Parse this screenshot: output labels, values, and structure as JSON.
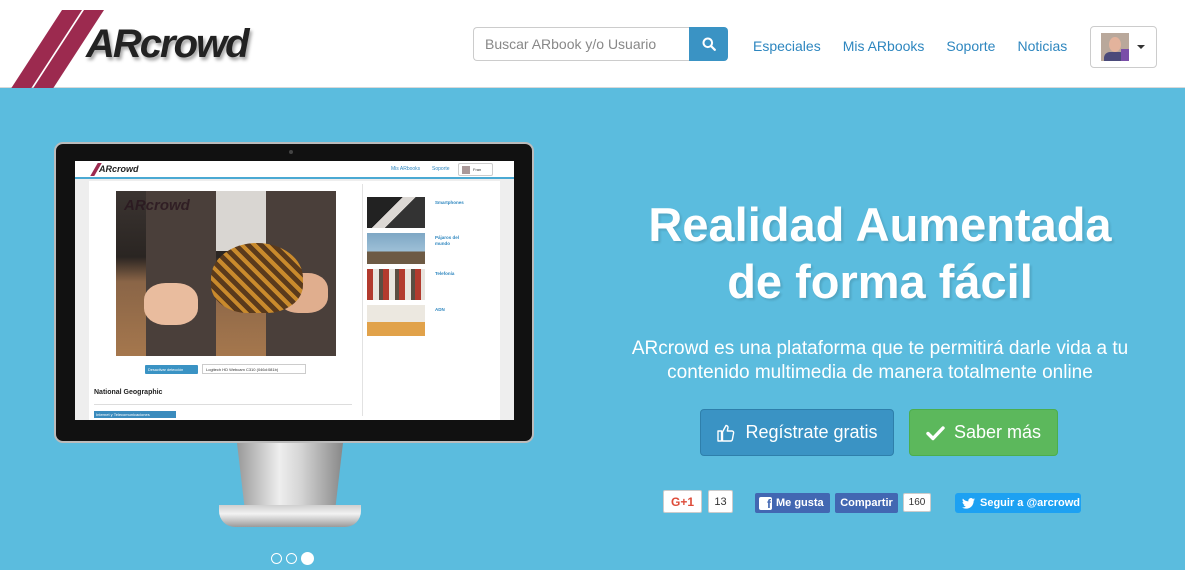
{
  "brand": {
    "logo_text": "ARcrowd",
    "color": "#9c2a4f"
  },
  "search": {
    "placeholder": "Buscar ARbook y/o Usuario",
    "button_icon": "search-icon"
  },
  "nav": {
    "links": [
      "Especiales",
      "Mis ARbooks",
      "Soporte",
      "Noticias"
    ]
  },
  "user_menu": {
    "icon": "avatar",
    "caret": "chevron-down-icon"
  },
  "hero": {
    "title_line1": "Realidad Aumentada",
    "title_line2": "de forma fácil",
    "subtitle_line1": "ARcrowd es una plataforma que te permitirá darle vida a tu",
    "subtitle_line2": "contenido multimedia de manera totalmente online",
    "register_label": "Regístrate gratis",
    "more_label": "Saber más",
    "background": "#5bbcde"
  },
  "monitor_screen": {
    "logo": "ARcrowd",
    "nav_link1": "Mis ARbooks",
    "nav_link2": "Soporte",
    "user": "Fran",
    "photo_watermark": "ARcrowd",
    "detect_button": "Desactivar detección",
    "camera_select": "Logitech HD Webcam C310 (046d:081b)",
    "heading": "National Geographic",
    "tag": "Internet y Telecomunicaciones",
    "thumbs": [
      "Smartphones",
      "Pájaros del mundo",
      "Telefonía",
      "ADN"
    ]
  },
  "social": {
    "gplus_label": "G+1",
    "gplus_count": "13",
    "fb_like": "Me gusta",
    "fb_share": "Compartir",
    "fb_count": "160",
    "twitter": "Seguir a @arcrowd"
  },
  "carousel": {
    "slides": 3,
    "active": 3
  }
}
